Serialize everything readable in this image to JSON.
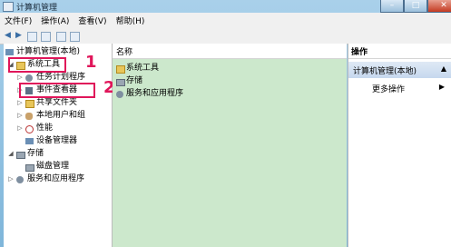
{
  "window": {
    "title": "计算机管理",
    "min": "–",
    "max": "□",
    "close": "✕"
  },
  "menu": [
    "文件(F)",
    "操作(A)",
    "查看(V)",
    "帮助(H)"
  ],
  "toolbar": {
    "back": "◀",
    "forward": "▶"
  },
  "tree": {
    "root": "计算机管理(本地)",
    "system_tools": "系统工具",
    "task_scheduler": "任务计划程序",
    "event_viewer": "事件查看器",
    "shared_folders": "共享文件夹",
    "local_users": "本地用户和组",
    "performance": "性能",
    "device_manager": "设备管理器",
    "storage": "存储",
    "disk_mgmt": "磁盘管理",
    "services_apps": "服务和应用程序"
  },
  "list": {
    "header": "名称",
    "items": [
      "系统工具",
      "存储",
      "服务和应用程序"
    ]
  },
  "actions": {
    "header": "操作",
    "selected": "计算机管理(本地)",
    "more": "更多操作"
  },
  "annotations": [
    "1",
    "2"
  ],
  "colors": {
    "highlight": "#e0165a",
    "list_bg": "#cce8cc"
  }
}
